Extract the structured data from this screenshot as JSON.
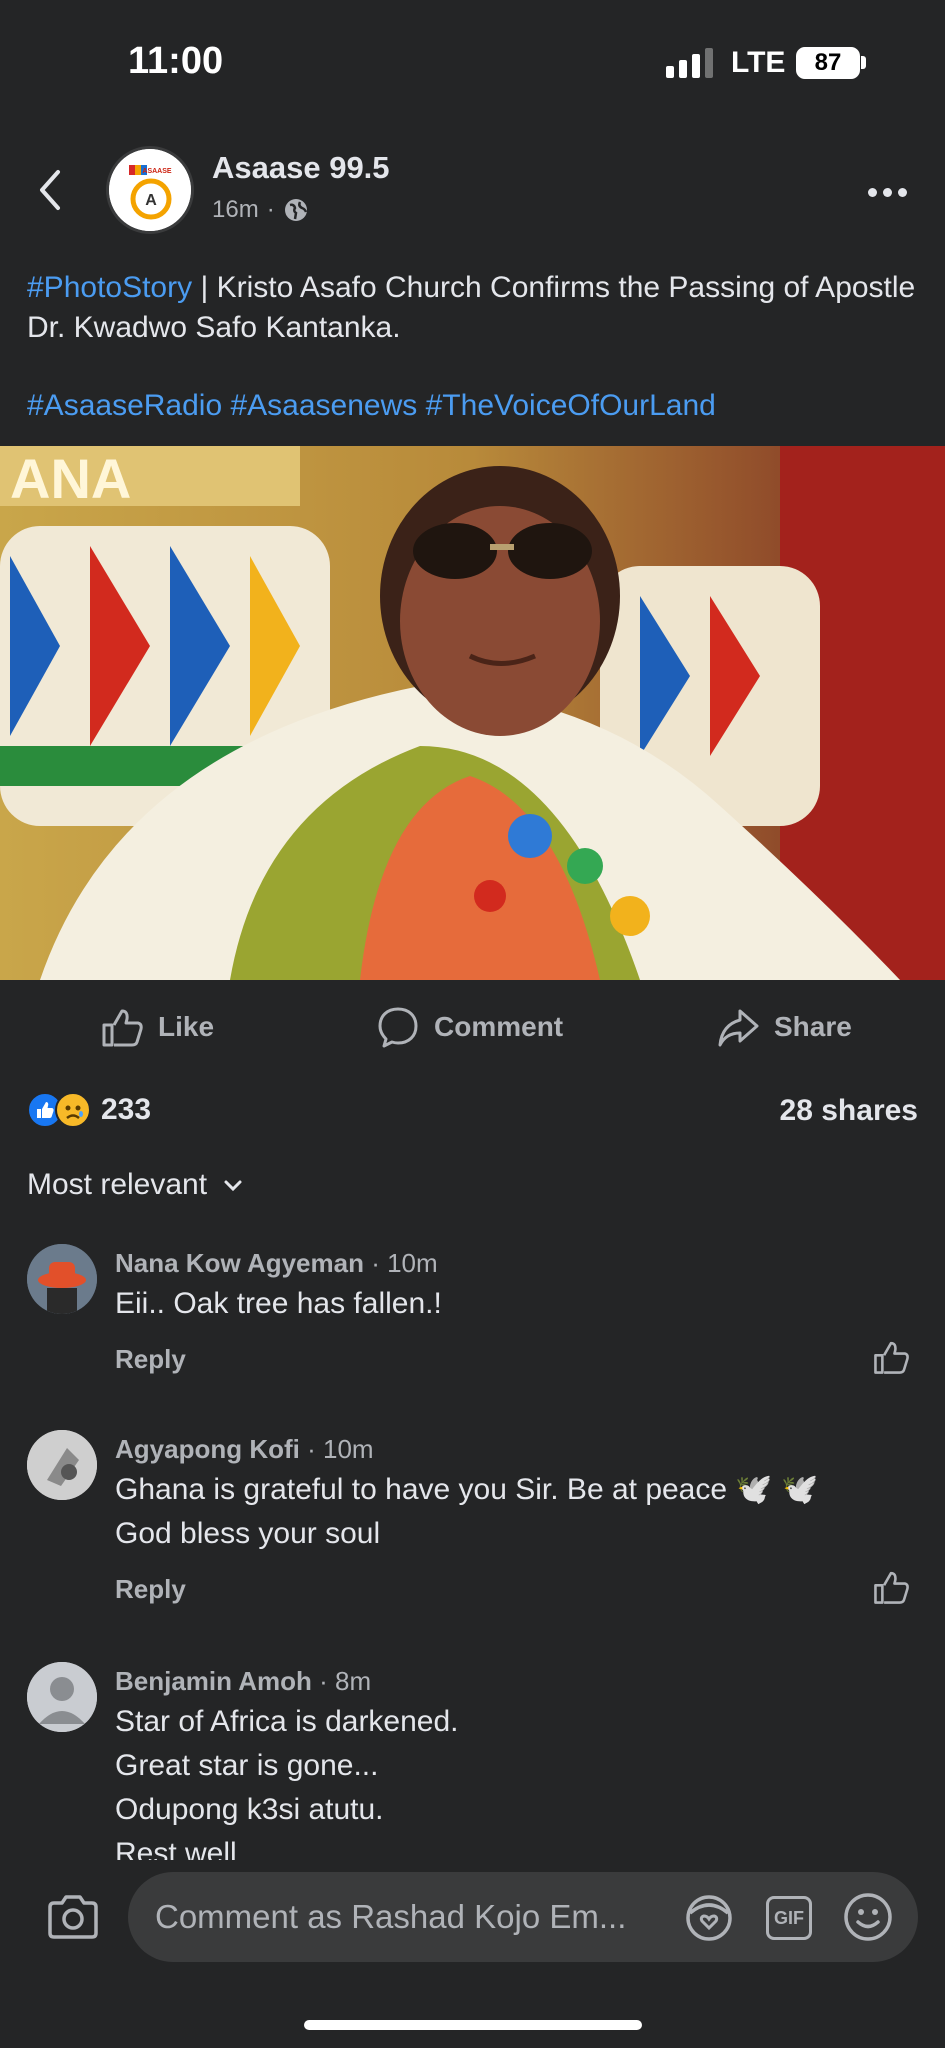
{
  "status_bar": {
    "time": "11:00",
    "network": "LTE",
    "battery": "87"
  },
  "header": {
    "page_name": "Asaase 99.5",
    "avatar_text": "ASAASE",
    "time_ago": "16m",
    "separator": "·",
    "audience_icon": "globe-icon"
  },
  "post": {
    "hashtag_lead": "#PhotoStory",
    "text": " | Kristo Asafo Church Confirms the Passing of Apostle Dr. Kwadwo Safo Kantanka.",
    "hashtags": [
      "#AsaaseRadio",
      "#Asaasenews",
      "#TheVoiceOfOurLand"
    ],
    "photo_banner": "ANA"
  },
  "actions": {
    "like": "Like",
    "comment": "Comment",
    "share": "Share"
  },
  "stats": {
    "reactions": "233",
    "shares": "28 shares"
  },
  "sort": {
    "label": "Most relevant"
  },
  "comments": [
    {
      "name": "Nana Kow Agyeman",
      "time": " · 10m",
      "lines": [
        "Eii.. Oak tree has fallen.!"
      ],
      "reply": "Reply"
    },
    {
      "name": "Agyapong Kofi",
      "time": " · 10m",
      "lines": [
        "Ghana is grateful to have you Sir. Be at peace 🕊️ 🕊️",
        "God bless your soul"
      ],
      "reply": "Reply"
    },
    {
      "name": "Benjamin Amoh",
      "time": " · 8m",
      "lines": [
        "Star of Africa is darkened.",
        "Great star is gone...",
        "Odupong k3si atutu.",
        "Rest well"
      ]
    }
  ],
  "composer": {
    "placeholder": "Comment as Rashad Kojo Em...",
    "gif": "GIF"
  },
  "colors": {
    "background": "#242526",
    "link": "#4b9cf1",
    "like_blue": "#1877f2",
    "input": "#3a3b3c"
  }
}
